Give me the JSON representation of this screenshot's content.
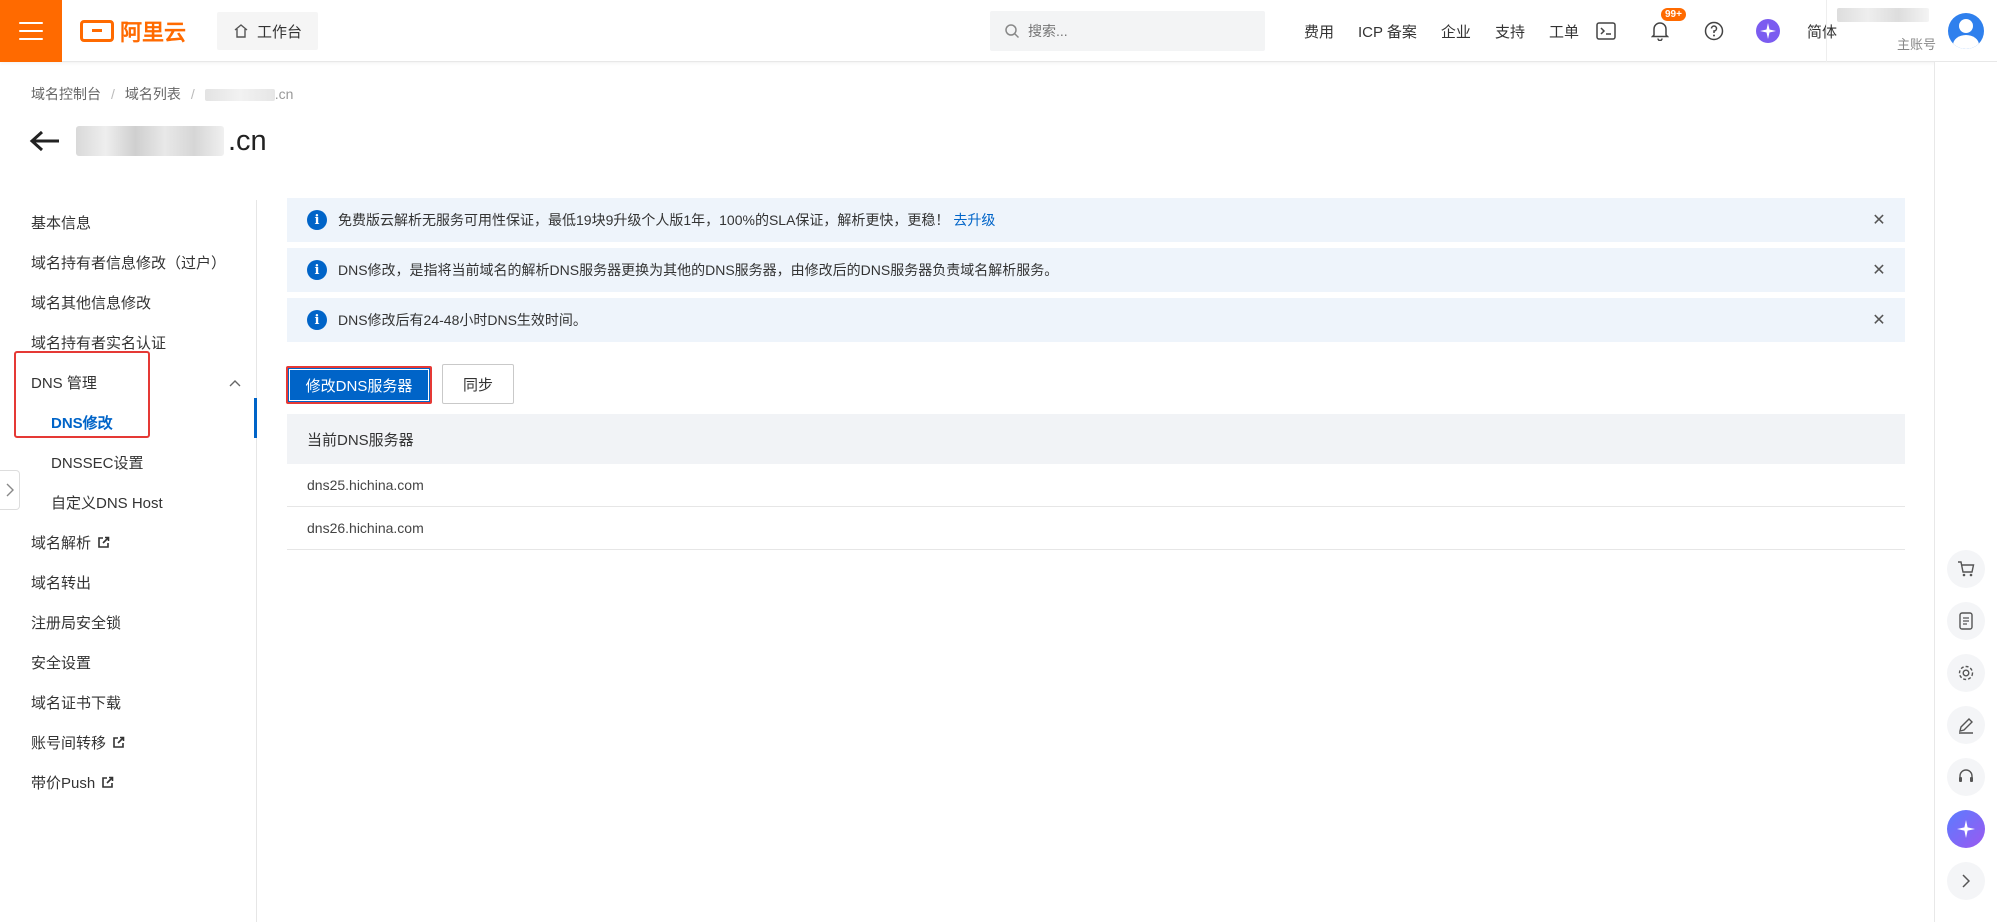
{
  "topbar": {
    "logo_text": "阿里云",
    "workbench_label": "工作台",
    "search_placeholder": "搜索...",
    "nav": [
      "费用",
      "ICP 备案",
      "企业",
      "支持",
      "工单"
    ],
    "notification_badge": "99+",
    "language": "简体",
    "account_label": "主账号"
  },
  "breadcrumb": {
    "items": [
      "域名控制台",
      "域名列表"
    ],
    "current_suffix": ".cn"
  },
  "page": {
    "title_suffix": ".cn"
  },
  "sidebar": {
    "items": [
      {
        "label": "基本信息"
      },
      {
        "label": "域名持有者信息修改（过户）"
      },
      {
        "label": "域名其他信息修改"
      },
      {
        "label": "域名持有者实名认证"
      },
      {
        "label": "DNS 管理"
      },
      {
        "label": "DNS修改"
      },
      {
        "label": "DNSSEC设置"
      },
      {
        "label": "自定义DNS Host"
      },
      {
        "label": "域名解析"
      },
      {
        "label": "域名转出"
      },
      {
        "label": "注册局安全锁"
      },
      {
        "label": "安全设置"
      },
      {
        "label": "域名证书下载"
      },
      {
        "label": "账号间转移"
      },
      {
        "label": "带价Push"
      }
    ]
  },
  "alerts": [
    {
      "text": "免费版云解析无服务可用性保证，最低19块9升级个人版1年，100%的SLA保证，解析更快，更稳！",
      "link": "去升级"
    },
    {
      "text": "DNS修改，是指将当前域名的解析DNS服务器更换为其他的DNS服务器，由修改后的DNS服务器负责域名解析服务。",
      "link": ""
    },
    {
      "text": "DNS修改后有24-48小时DNS生效时间。",
      "link": ""
    }
  ],
  "actions": {
    "modify_dns": "修改DNS服务器",
    "sync": "同步"
  },
  "dns_table": {
    "header": "当前DNS服务器",
    "rows": [
      "dns25.hichina.com",
      "dns26.hichina.com"
    ]
  },
  "colors": {
    "brand": "#ff6a00",
    "primary": "#0064c8",
    "highlight": "#e53935"
  }
}
